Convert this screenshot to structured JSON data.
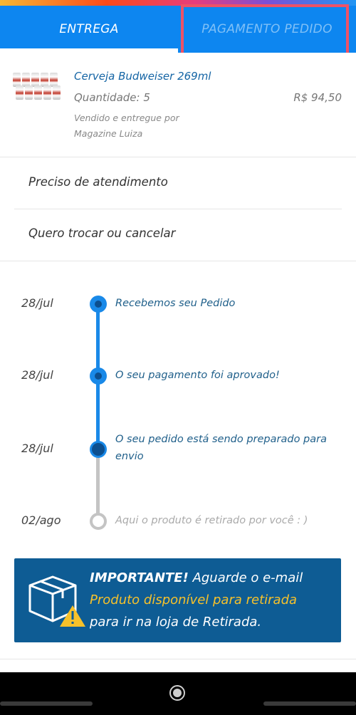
{
  "tabs": [
    {
      "label": "ENTREGA",
      "active": true
    },
    {
      "label": "PAGAMENTO PEDIDO",
      "active": false
    }
  ],
  "product": {
    "name": "Cerveja Budweiser 269ml",
    "quantity": "Quantidade: 5",
    "price": "R$ 94,50",
    "seller_line1": "Vendido e entregue por",
    "seller_line2": "Magazine Luiza"
  },
  "actions": {
    "help": "Preciso de atendimento",
    "exchange": "Quero trocar ou cancelar"
  },
  "timeline": [
    {
      "date": "28/jul",
      "text": "Recebemos seu Pedido",
      "status": "done"
    },
    {
      "date": "28/jul",
      "text": "O seu pagamento foi aprovado!",
      "status": "done"
    },
    {
      "date": "28/jul",
      "text": "O seu pedido está sendo preparado para envio",
      "status": "current"
    },
    {
      "date": "02/ago",
      "text": "Aqui o produto é retirado por você : )",
      "status": "pending"
    }
  ],
  "important": {
    "title": "IMPORTANTE!",
    "line1_rest": "Aguarde o e-mail",
    "highlight": "Produto disponível para retirada",
    "line3": "para ir na loja de Retirada."
  },
  "colors": {
    "primary": "#0d86f0",
    "link": "#1565a5",
    "important_bg": "#0e5c94",
    "important_highlight": "#f6c12b",
    "annotation_box": "#ee5267"
  }
}
